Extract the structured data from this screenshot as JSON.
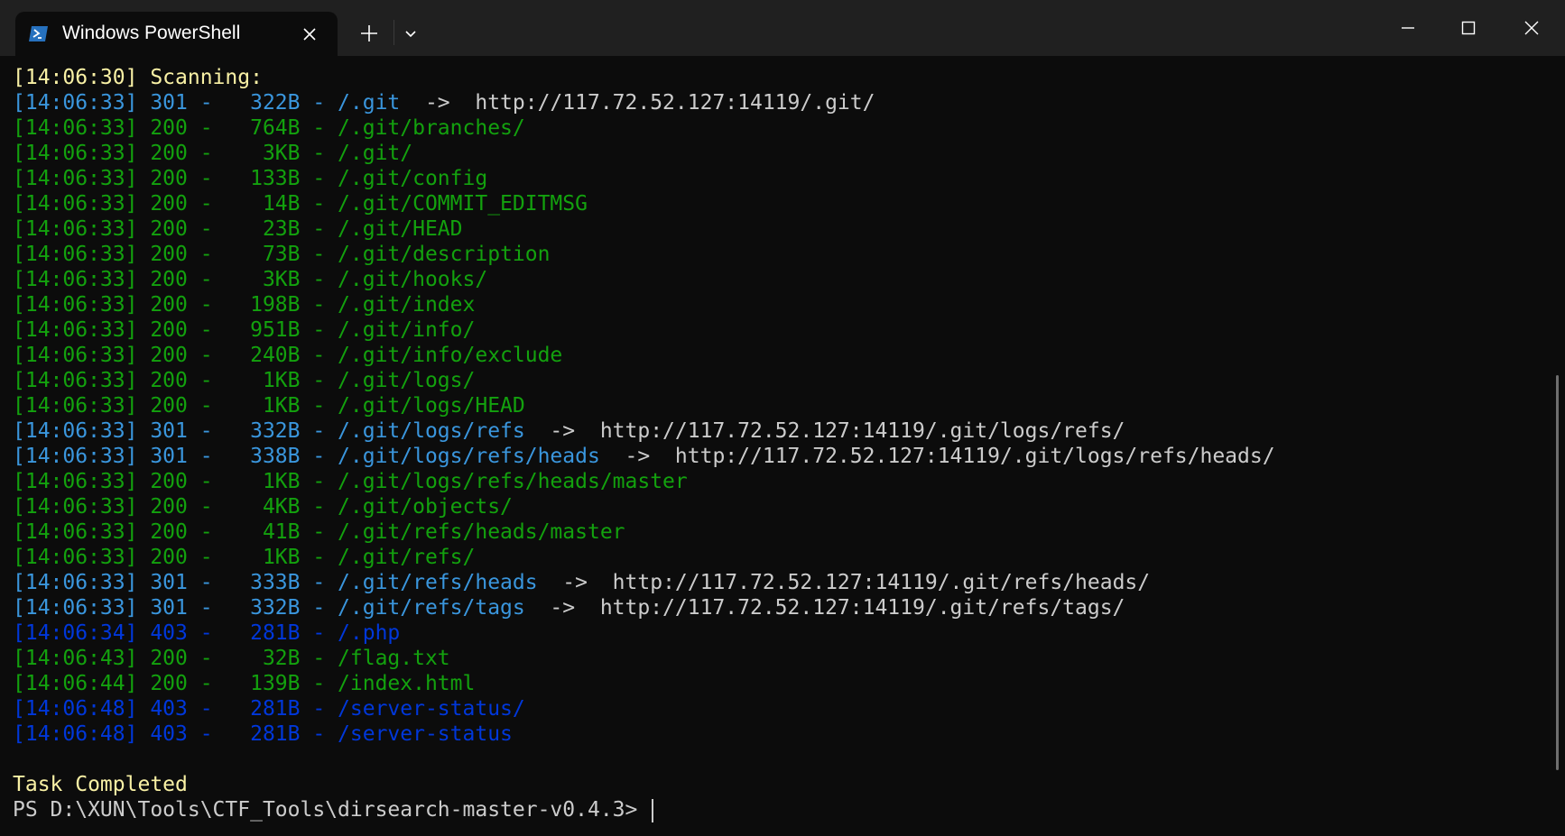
{
  "window": {
    "tab_title": "Windows PowerShell",
    "tab_icon": "powershell-icon",
    "new_tab_icon": "plus-icon",
    "dropdown_icon": "chevron-down-icon",
    "minimize_icon": "minimize-icon",
    "maximize_icon": "maximize-icon",
    "close_icon": "close-icon"
  },
  "colors": {
    "background": "#0c0c0c",
    "titlebar": "#202020",
    "yellow": "#f9f1a5",
    "green": "#13a10e",
    "cyan": "#3a96dd",
    "blue": "#0037da",
    "white": "#cccccc"
  },
  "terminal": {
    "lines": [
      {
        "color": "yellow",
        "text": "[14:06:30] Scanning:"
      },
      {
        "color": "cyan",
        "text": "[14:06:33] 301 -   322B - /.git",
        "suffix": "  ->  http://117.72.52.127:14119/.git/"
      },
      {
        "color": "green",
        "text": "[14:06:33] 200 -   764B - /.git/branches/"
      },
      {
        "color": "green",
        "text": "[14:06:33] 200 -    3KB - /.git/"
      },
      {
        "color": "green",
        "text": "[14:06:33] 200 -   133B - /.git/config"
      },
      {
        "color": "green",
        "text": "[14:06:33] 200 -    14B - /.git/COMMIT_EDITMSG"
      },
      {
        "color": "green",
        "text": "[14:06:33] 200 -    23B - /.git/HEAD"
      },
      {
        "color": "green",
        "text": "[14:06:33] 200 -    73B - /.git/description"
      },
      {
        "color": "green",
        "text": "[14:06:33] 200 -    3KB - /.git/hooks/"
      },
      {
        "color": "green",
        "text": "[14:06:33] 200 -   198B - /.git/index"
      },
      {
        "color": "green",
        "text": "[14:06:33] 200 -   951B - /.git/info/"
      },
      {
        "color": "green",
        "text": "[14:06:33] 200 -   240B - /.git/info/exclude"
      },
      {
        "color": "green",
        "text": "[14:06:33] 200 -    1KB - /.git/logs/"
      },
      {
        "color": "green",
        "text": "[14:06:33] 200 -    1KB - /.git/logs/HEAD"
      },
      {
        "color": "cyan",
        "text": "[14:06:33] 301 -   332B - /.git/logs/refs",
        "suffix": "  ->  http://117.72.52.127:14119/.git/logs/refs/"
      },
      {
        "color": "cyan",
        "text": "[14:06:33] 301 -   338B - /.git/logs/refs/heads",
        "suffix": "  ->  http://117.72.52.127:14119/.git/logs/refs/heads/"
      },
      {
        "color": "green",
        "text": "[14:06:33] 200 -    1KB - /.git/logs/refs/heads/master"
      },
      {
        "color": "green",
        "text": "[14:06:33] 200 -    4KB - /.git/objects/"
      },
      {
        "color": "green",
        "text": "[14:06:33] 200 -    41B - /.git/refs/heads/master"
      },
      {
        "color": "green",
        "text": "[14:06:33] 200 -    1KB - /.git/refs/"
      },
      {
        "color": "cyan",
        "text": "[14:06:33] 301 -   333B - /.git/refs/heads",
        "suffix": "  ->  http://117.72.52.127:14119/.git/refs/heads/"
      },
      {
        "color": "cyan",
        "text": "[14:06:33] 301 -   332B - /.git/refs/tags",
        "suffix": "  ->  http://117.72.52.127:14119/.git/refs/tags/"
      },
      {
        "color": "blue",
        "text": "[14:06:34] 403 -   281B - /.php"
      },
      {
        "color": "green",
        "text": "[14:06:43] 200 -    32B - /flag.txt"
      },
      {
        "color": "green",
        "text": "[14:06:44] 200 -   139B - /index.html"
      },
      {
        "color": "blue",
        "text": "[14:06:48] 403 -   281B - /server-status/"
      },
      {
        "color": "blue",
        "text": "[14:06:48] 403 -   281B - /server-status"
      },
      {
        "color": "white",
        "text": ""
      },
      {
        "color": "yellow",
        "text": "Task Completed"
      }
    ],
    "prompt": "PS D:\\XUN\\Tools\\CTF_Tools\\dirsearch-master-v0.4.3> "
  }
}
